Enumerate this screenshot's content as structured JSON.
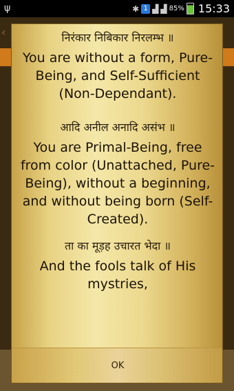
{
  "status_bar": {
    "battery_percent": "85%",
    "time": "15:33",
    "notification_badge": "1",
    "battery_level": 0.85
  },
  "dialog": {
    "verses": [
      {
        "gurmukhi": "निरंकार निबिकार निरलम्भ ॥",
        "translation": "You are without a form, Pure-Being, and Self-Sufficient (Non-Dependant)."
      },
      {
        "gurmukhi": "आदि अनील अनादि असंभ ॥",
        "translation": "You are Primal-Being, free from color (Unattached, Pure-Being), without a beginning, and without being born (Self-Created)."
      },
      {
        "gurmukhi": "ता का मूड़ह उचारत भेदा ॥",
        "translation": "And the fools talk of His mystries,"
      }
    ],
    "ok_label": "OK"
  }
}
